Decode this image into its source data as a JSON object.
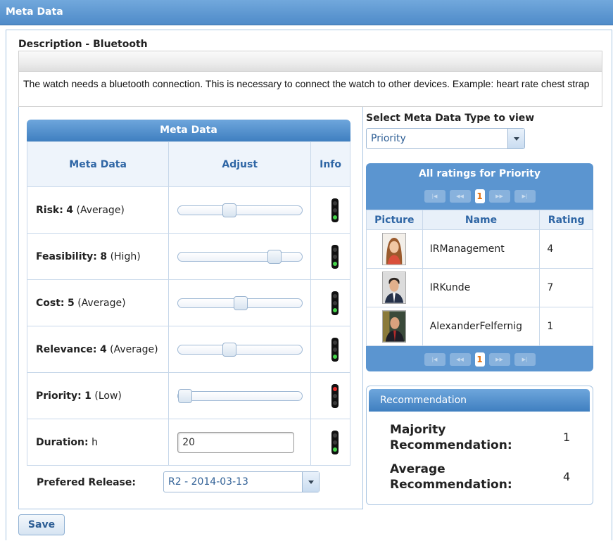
{
  "window": {
    "title": "Meta Data"
  },
  "description": {
    "title": "Description - Bluetooth",
    "text": "The watch needs a bluetooth connection. This is necessary to connect the watch to other devices. Example: heart rate chest strap"
  },
  "meta_table": {
    "title": "Meta Data",
    "headers": {
      "meta": "Meta Data",
      "adjust": "Adjust",
      "info": "Info"
    },
    "rows": [
      {
        "label": "Risk:",
        "value": "4",
        "level": "(Average)",
        "slider_fraction": 0.4,
        "light": "green"
      },
      {
        "label": "Feasibility:",
        "value": "8",
        "level": "(High)",
        "slider_fraction": 0.8,
        "light": "green"
      },
      {
        "label": "Cost:",
        "value": "5",
        "level": "(Average)",
        "slider_fraction": 0.5,
        "light": "green"
      },
      {
        "label": "Relevance:",
        "value": "4",
        "level": "(Average)",
        "slider_fraction": 0.4,
        "light": "green"
      },
      {
        "label": "Priority:",
        "value": "1",
        "level": "(Low)",
        "slider_fraction": 0.0,
        "light": "red"
      }
    ],
    "duration": {
      "label": "Duration:",
      "unit": "h",
      "value": "20",
      "light": "green"
    }
  },
  "release": {
    "label": "Prefered Release:",
    "selected": "R2 - 2014-03-13"
  },
  "save_label": "Save",
  "type_selector": {
    "label": "Select Meta Data Type to view",
    "selected": "Priority"
  },
  "ratings": {
    "title": "All ratings for Priority",
    "page": "1",
    "headers": {
      "picture": "Picture",
      "name": "Name",
      "rating": "Rating"
    },
    "rows": [
      {
        "name": "IRManagement",
        "rating": "4"
      },
      {
        "name": "IRKunde",
        "rating": "7"
      },
      {
        "name": "AlexanderFelfernig",
        "rating": "1"
      }
    ]
  },
  "recommendation": {
    "title": "Recommendation",
    "majority_label": "Majority Recommendation:",
    "majority_value": "1",
    "average_label": "Average Recommendation:",
    "average_value": "4"
  }
}
